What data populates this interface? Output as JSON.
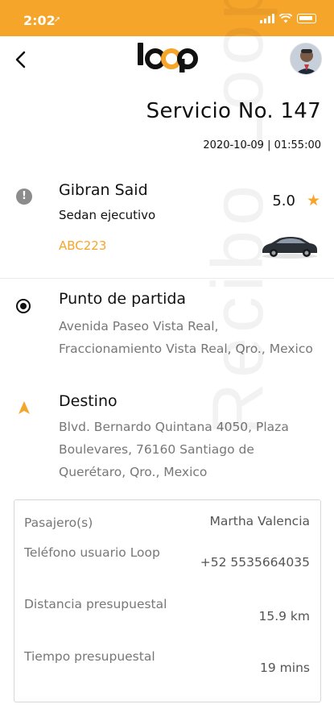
{
  "status_bar": {
    "time": "2:02",
    "location_arrow": "➚"
  },
  "nav": {
    "back_icon": "chevron-left-icon",
    "logo_text": "loop"
  },
  "service": {
    "title": "Servicio No. 147",
    "datetime": "2020-10-09 | 01:55:00"
  },
  "driver": {
    "name": "Gibran Said",
    "car_type": "Sedan ejecutivo",
    "plate": "ABC223",
    "rating": "5.0",
    "alert_icon": "!"
  },
  "origin": {
    "label": "Punto de partida",
    "address": "Avenida Paseo Vista Real, Fraccionamiento Vista Real, Qro., Mexico"
  },
  "destination": {
    "label": "Destino",
    "address": "Blvd. Bernardo Quintana 4050, Plaza Boulevares, 76160 Santiago de Querétaro, Qro., Mexico"
  },
  "details": {
    "passenger_label": "Pasajero(s)",
    "passenger_value": "Martha Valencia",
    "phone_label": "Teléfono usuario Loop",
    "phone_value": "+52 5535664035",
    "distance_label": "Distancia presupuestal",
    "distance_value": "15.9 km",
    "time_label": "Tiempo presupuestal",
    "time_value": "19 mins"
  },
  "watermark": "Recibo Loop",
  "colors": {
    "accent": "#f6a52b"
  }
}
